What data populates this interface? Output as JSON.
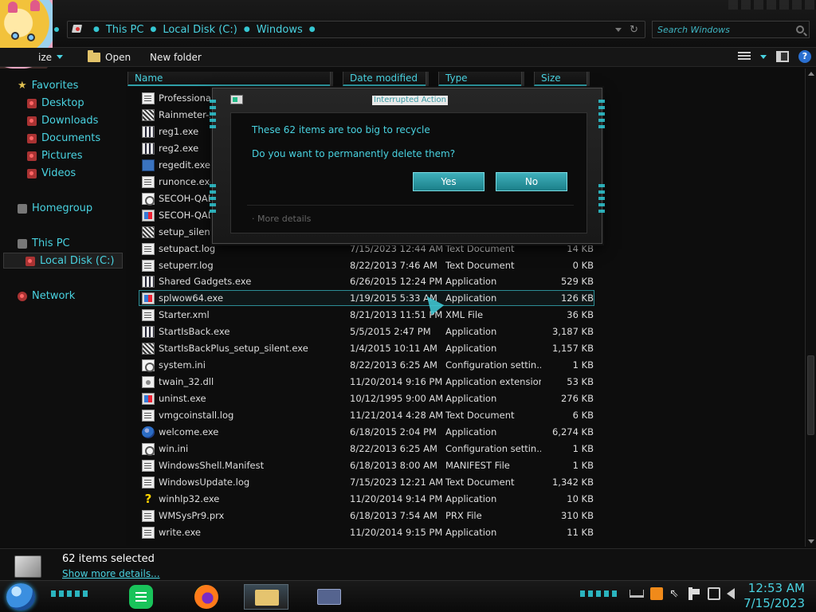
{
  "address": {
    "crumbs": [
      "This PC",
      "Local Disk (C:)",
      "Windows"
    ],
    "search_placeholder": "Search Windows"
  },
  "toolbar": {
    "organize_partial": "ize",
    "open_label": "Open",
    "new_folder_label": "New folder",
    "help_label": "?"
  },
  "nav": {
    "favorites": "Favorites",
    "desktop": "Desktop",
    "downloads": "Downloads",
    "documents": "Documents",
    "pictures": "Pictures",
    "videos": "Videos",
    "homegroup": "Homegroup",
    "this_pc": "This PC",
    "local_disk": "Local Disk (C:)",
    "network": "Network"
  },
  "columns": {
    "name": "Name",
    "date": "Date modified",
    "type": "Type",
    "size": "Size"
  },
  "files": [
    {
      "name": "Professional.x",
      "date": "",
      "type": "",
      "size": "",
      "icon": "log"
    },
    {
      "name": "Rainmeter-3.2",
      "date": "",
      "type": "",
      "size": "",
      "icon": "setup"
    },
    {
      "name": "reg1.exe",
      "date": "",
      "type": "",
      "size": "",
      "icon": "setupreg"
    },
    {
      "name": "reg2.exe",
      "date": "",
      "type": "",
      "size": "",
      "icon": "setupreg"
    },
    {
      "name": "regedit.exe",
      "date": "",
      "type": "",
      "size": "",
      "icon": "regedit"
    },
    {
      "name": "runonce.exe",
      "date": "",
      "type": "",
      "size": "",
      "icon": "log"
    },
    {
      "name": "SECOH-QAD.",
      "date": "",
      "type": "",
      "size": "",
      "icon": "ini"
    },
    {
      "name": "SECOH-QAD.",
      "date": "",
      "type": "",
      "size": "",
      "icon": "exe"
    },
    {
      "name": "setup_silent.exe",
      "date": "",
      "type": "",
      "size": "",
      "icon": "setup"
    },
    {
      "name": "setupact.log",
      "date": "7/15/2023 12:44 AM",
      "type": "Text Document",
      "size": "14 KB",
      "icon": "log"
    },
    {
      "name": "setuperr.log",
      "date": "8/22/2013 7:46 AM",
      "type": "Text Document",
      "size": "0 KB",
      "icon": "log"
    },
    {
      "name": "Shared Gadgets.exe",
      "date": "6/26/2015 12:24 PM",
      "type": "Application",
      "size": "529 KB",
      "icon": "setupreg"
    },
    {
      "name": "splwow64.exe",
      "date": "1/19/2015 5:33 AM",
      "type": "Application",
      "size": "126 KB",
      "icon": "exe"
    },
    {
      "name": "Starter.xml",
      "date": "8/21/2013 11:51 PM",
      "type": "XML File",
      "size": "36 KB",
      "icon": "log"
    },
    {
      "name": "StartIsBack.exe",
      "date": "5/5/2015 2:47 PM",
      "type": "Application",
      "size": "3,187 KB",
      "icon": "setupreg"
    },
    {
      "name": "StartIsBackPlus_setup_silent.exe",
      "date": "1/4/2015 10:11 AM",
      "type": "Application",
      "size": "1,157 KB",
      "icon": "setup"
    },
    {
      "name": "system.ini",
      "date": "8/22/2013 6:25 AM",
      "type": "Configuration settin...",
      "size": "1 KB",
      "icon": "ini"
    },
    {
      "name": "twain_32.dll",
      "date": "11/20/2014 9:16 PM",
      "type": "Application extension",
      "size": "53 KB",
      "icon": "dll"
    },
    {
      "name": "uninst.exe",
      "date": "10/12/1995 9:00 AM",
      "type": "Application",
      "size": "276 KB",
      "icon": "exe"
    },
    {
      "name": "vmgcoinstall.log",
      "date": "11/21/2014 4:28 AM",
      "type": "Text Document",
      "size": "6 KB",
      "icon": "log"
    },
    {
      "name": "welcome.exe",
      "date": "6/18/2015 2:04 PM",
      "type": "Application",
      "size": "6,274 KB",
      "icon": "globe"
    },
    {
      "name": "win.ini",
      "date": "8/22/2013 6:25 AM",
      "type": "Configuration settin...",
      "size": "1 KB",
      "icon": "ini"
    },
    {
      "name": "WindowsShell.Manifest",
      "date": "6/18/2013 8:00 AM",
      "type": "MANIFEST File",
      "size": "1 KB",
      "icon": "log"
    },
    {
      "name": "WindowsUpdate.log",
      "date": "7/15/2023 12:21 AM",
      "type": "Text Document",
      "size": "1,342 KB",
      "icon": "log"
    },
    {
      "name": "winhlp32.exe",
      "date": "11/20/2014 9:14 PM",
      "type": "Application",
      "size": "10 KB",
      "icon": "help"
    },
    {
      "name": "WMSysPr9.prx",
      "date": "6/18/2013 7:54 AM",
      "type": "PRX File",
      "size": "310 KB",
      "icon": "log"
    },
    {
      "name": "write.exe",
      "date": "11/20/2014 9:15 PM",
      "type": "Application",
      "size": "11 KB",
      "icon": "log"
    }
  ],
  "dialog": {
    "title": "Interrupted Action",
    "line1": "These 62 items are too big to recycle",
    "line2": "Do you want to permanently delete them?",
    "yes": "Yes",
    "no": "No",
    "more_details": "More details"
  },
  "details": {
    "count": "62 items selected",
    "show_more": "Show more details..."
  },
  "clock": {
    "time": "12:53 AM",
    "date": "7/15/2023"
  },
  "colors": {
    "accent": "#49d2e0",
    "button": "#2fa2ad",
    "background": "#0d0d0d"
  }
}
